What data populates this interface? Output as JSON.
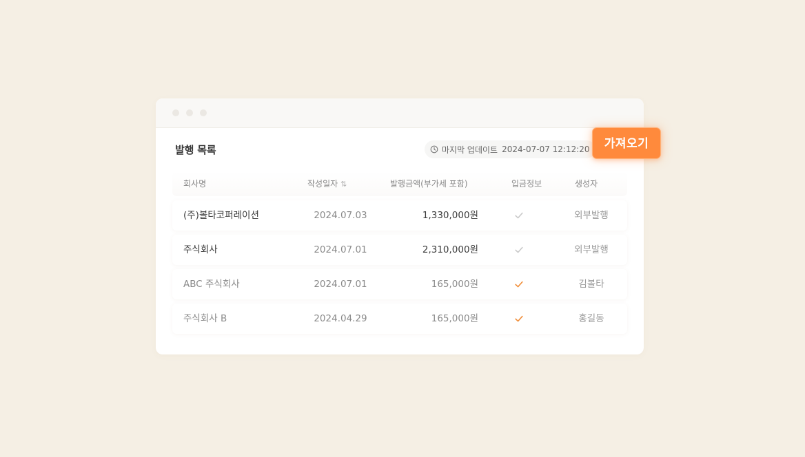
{
  "header": {
    "title": "발행 목록",
    "update_label": "마지막 업데이트",
    "update_time": "2024-07-07 12:12:20"
  },
  "table": {
    "columns": {
      "company": "회사명",
      "date": "작성일자",
      "amount": "발행금액(부가세 포함)",
      "payment": "입금정보",
      "creator": "생성자"
    },
    "rows": [
      {
        "company": "(주)볼타코퍼레이션",
        "date": "2024.07.03",
        "amount": "1,330,000원",
        "paid": false,
        "creator": "외부발행"
      },
      {
        "company": "주식회사",
        "date": "2024.07.01",
        "amount": "2,310,000원",
        "paid": false,
        "creator": "외부발행"
      },
      {
        "company": "ABC 주식회사",
        "date": "2024.07.01",
        "amount": "165,000원",
        "paid": true,
        "creator": "김볼타"
      },
      {
        "company": "주식회사 B",
        "date": "2024.04.29",
        "amount": "165,000원",
        "paid": true,
        "creator": "홍길동"
      }
    ]
  },
  "actions": {
    "fetch_label": "가져오기"
  },
  "colors": {
    "accent": "#ff8a3c",
    "check_paid": "#f08a33",
    "check_unpaid": "#c8c8c8"
  },
  "icons": {
    "clock": "clock-icon",
    "sort": "sort-icon",
    "check": "check-icon"
  }
}
